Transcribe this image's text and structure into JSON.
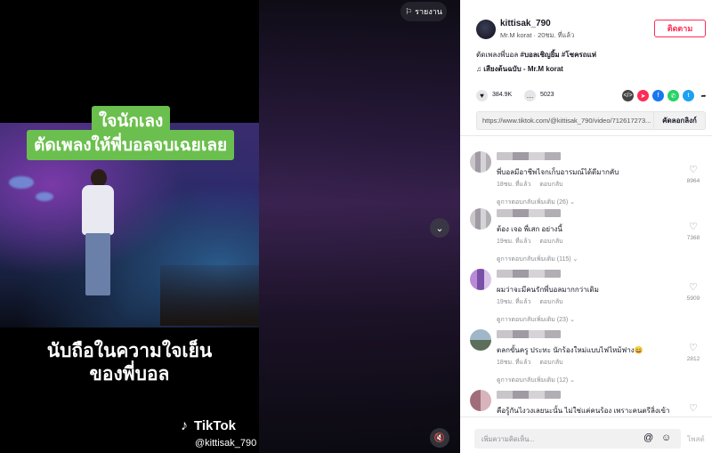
{
  "video": {
    "caption_top": "ใจนักเลง",
    "caption_mid": "ตัดเพลงให้พี่บอลจบเฉยเลย",
    "bottom_line1": "นับถือในความใจเย็น",
    "bottom_line2": "ของพี่บอล",
    "watermark_brand": "TikTok",
    "watermark_user": "@kittisak_790",
    "report_label": "รายงาน"
  },
  "author": {
    "username": "kittisak_790",
    "meta": "Mr.M korat · 20ชม. ที่แล้ว",
    "follow_label": "ติดตาม"
  },
  "post": {
    "description_plain": "ตัดเพลงพี่บอล ",
    "hashtags": "#บอลเชิญยิ้ม #โชครถแห่",
    "music": "♫  เสียงต้นฉบับ - Mr.M korat"
  },
  "stats": {
    "likes": "384.9K",
    "comments": "5023"
  },
  "share_colors": [
    "#444444",
    "#fe2c55",
    "#1877f2",
    "#25d366",
    "#1da1f2"
  ],
  "link": {
    "url": "https://www.tiktok.com/@kittisak_790/video/712617273...",
    "copy_label": "คัดลอกลิงก์"
  },
  "comments": [
    {
      "text": "พี่บอลมีอาชีพไจกเก็บอารมณ์ได้ดีมากคับ",
      "time": "18ชม. ที่แล้ว",
      "reply": "ตอบกลับ",
      "likes": "8964",
      "more_replies": "ดูการตอบกลับเพิ่มเติม (26)"
    },
    {
      "text": "ต้อง เจอ พี่เสก อย่างนี้",
      "time": "19ชม. ที่แล้ว",
      "reply": "ตอบกลับ",
      "likes": "7368",
      "more_replies": "ดูการตอบกลับเพิ่มเติม (115)"
    },
    {
      "text": "ผมว่าจะมีคนรักพี่บอลมากกว่าเดิม",
      "time": "19ชม. ที่แล้ว",
      "reply": "ตอบกลับ",
      "likes": "5909",
      "more_replies": "ดูการตอบกลับเพิ่มเติม (23)"
    },
    {
      "text": "ตลกขั้นครู ประทะ นักร้องใหม่แบบไฟไหม้ฟาง😄",
      "time": "18ชม. ที่แล้ว",
      "reply": "ตอบกลับ",
      "likes": "2812",
      "more_replies": "ดูการตอบกลับเพิ่มเติม (12)"
    },
    {
      "text": "คือรู้กันไงวงเลยนะนั้น ไม่ใช่แค่คนร้อง เพราะคนตรีลิ่งเข้า",
      "time": "",
      "reply": "",
      "likes": "",
      "more_replies": ""
    }
  ],
  "comment_box": {
    "placeholder": "เพิ่มความคิดเห็น...",
    "post_label": "โพสต์"
  }
}
